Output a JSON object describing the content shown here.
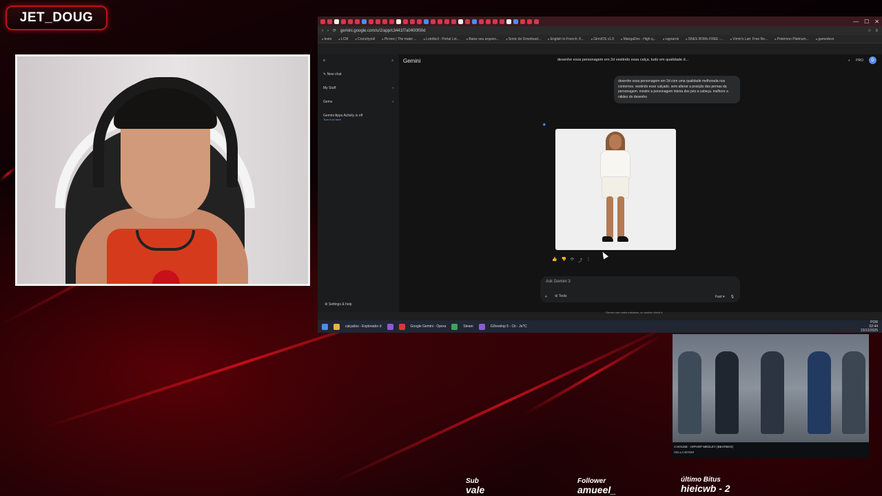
{
  "overlay": {
    "streamer_name": "JET_DOUG",
    "labels": {
      "sub_key": "Sub",
      "sub_value": "vale",
      "follower_key": "Follower",
      "follower_value": "amueel_",
      "bits_key": "último Bitus",
      "bits_value": "hieicwb - 2"
    }
  },
  "browser": {
    "url": "gemini.google.com/u/2/app/c3441f7a0400f00d",
    "bookmarks": [
      "testo",
      "LCM",
      "Crunchyroll",
      "Picrew | The make ...",
      "Lotofácil - Portal Lot...",
      "Baixe seu arquivo...",
      "Sonic de Download...",
      "English to French, K...",
      "GinniOS v1.0",
      "MangaDex - High q...",
      "ragnarok",
      "SNES ROMs FREE -...",
      "Vimm's Lair: Free Re...",
      "Pokémon Platinum...",
      "gamedevs"
    ],
    "window_controls": [
      "—",
      "☐",
      "✕"
    ]
  },
  "gemini": {
    "app_title": "Gemini",
    "conversation_title": "desenhe essa personagem em 2d vestindo essa calça. tudo em qualidade d...",
    "pro_badge": "PRO",
    "avatar_letter": "D",
    "sidebar": {
      "new_chat": "New chat",
      "my_stuff": "My Stuff",
      "gems": "Gems",
      "activity_title": "Gemini Apps Activity is off",
      "activity_sub": "Turn it on here",
      "settings": "Settings & help"
    },
    "user_message": "desenhe essa personagem em 2d com uma qualidade melhorada nos contornos. vestindo esse calçado. sem alterar a posição das pernas da personagem. mostre a personagem inteira dos pés a cabeça. melhore a nitidez do desenho",
    "prompt_placeholder": "Ask Gemini 3",
    "tools_label": "Tools",
    "mode_label": "Fast",
    "disclaimer": "Gemini can make mistakes, so double-check it"
  },
  "taskbar": {
    "items": [
      "calçados - Explorador d",
      "Google Gemini - Opera",
      "Steam",
      "GDevelop 5 - Cit - Je?C"
    ],
    "lang": "POR",
    "time": "02:44",
    "date": "23/12/2025"
  },
  "video": {
    "title": "A HOUSE - HIPHOP MEDLEY (BEATBOX)",
    "channel": "HELLA BOOM"
  }
}
